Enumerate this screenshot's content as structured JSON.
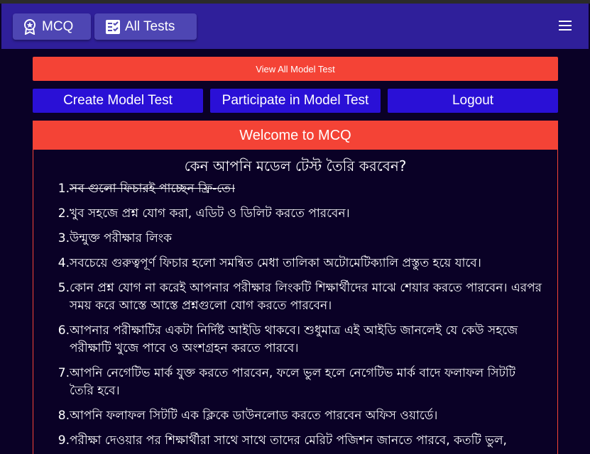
{
  "navbar": {
    "brand_label": "MCQ",
    "brand_icon": "badge-icon",
    "tests_label": "All Tests",
    "tests_icon": "checklist-icon",
    "menu_icon": "hamburger-menu-icon"
  },
  "actions": {
    "view_all": "View All Model Test",
    "create": "Create Model Test",
    "participate": "Participate in Model Test",
    "logout": "Logout"
  },
  "card": {
    "header": "Welcome to MCQ",
    "title": "কেন আপনি মডেল টেস্ট তৈরি করবেন?",
    "features": [
      {
        "num": "1.",
        "text": "সব গুলো ফিচারই পাচ্ছেন ফ্রি-তে।",
        "struck": true
      },
      {
        "num": "2.",
        "text": "খুব সহজে প্রশ্ন যোগ করা, এডিট ও ডিলিট করতে পারবেন।"
      },
      {
        "num": "3.",
        "text": "উন্মুক্ত পরীক্ষার লিংক"
      },
      {
        "num": "4.",
        "text": "সবচেয়ে গুরুত্বপূর্ণ ফিচার হলো সমন্বিত মেধা তালিকা অটোমেটিক্যালি প্রস্তুত হয়ে যাবে।"
      },
      {
        "num": "5.",
        "text": "কোন প্রশ্ন যোগ না করেই আপনার পরীক্ষার লিংকটি শিক্ষার্থীদের মাঝে শেয়ার করতে পারবেন। এরপর সময় করে আস্তে আস্তে প্রশ্নগুলো যোগ করতে পারবেন।"
      },
      {
        "num": "6.",
        "text": "আপনার পরীক্ষাটির একটা নির্দিষ্ট আইডি থাকবে। শুধুমাত্র এই আইডি জানলেই যে কেউ সহজে পরীক্ষাটি খুজে পাবে ও অংশগ্রহন করতে পারবে।"
      },
      {
        "num": "7.",
        "text": "আপনি নেগেটিভ মার্ক যুক্ত করতে পারবেন, ফলে ভুল হলে নেগেটিভ মার্ক বাদে ফলাফল সিটটি তৈরি হবে।"
      },
      {
        "num": "8.",
        "text": "আপনি ফলাফল সিটটি এক ক্লিকে ডাউনলোড করতে পারবেন অফিস ওয়ার্ডে।"
      },
      {
        "num": "9.",
        "text": "পরীক্ষা দেওয়ার পর শিক্ষার্থীরা সাথে সাথে তাদের মেরিট পজিশন জানতে পারবে, কতটি ভুল,"
      }
    ]
  },
  "colors": {
    "navbar": "#2f1f9a",
    "background": "#0a0126",
    "accent_red": "#f44336",
    "button_blue": "#2a10d6"
  }
}
